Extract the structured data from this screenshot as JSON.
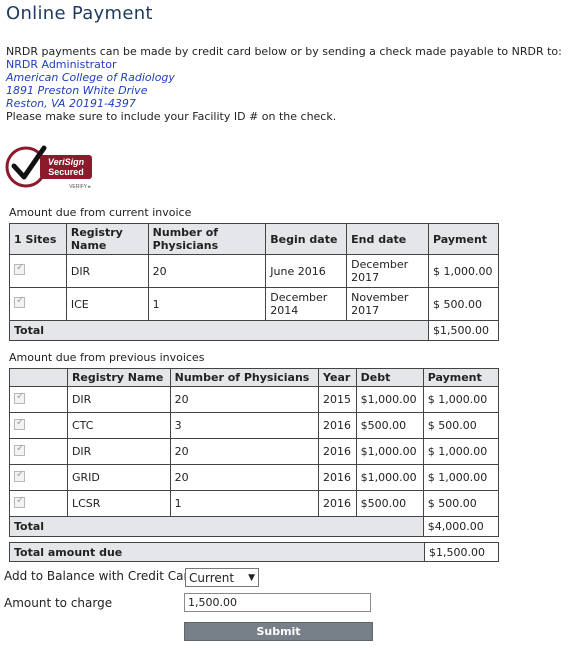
{
  "title": "Online Payment",
  "intro": {
    "line1": "NRDR payments can be made by credit card below or by sending a check made payable to NRDR to:",
    "addr_name": "NRDR Administrator",
    "addr_org": "American College of Radiology",
    "addr_street": "1891 Preston White Drive",
    "addr_city": "Reston, VA 20191-4397",
    "note": "Please make sure to include your Facility ID # on the check."
  },
  "verisign": {
    "line1": "VeriSign",
    "line2": "Secured",
    "line3": "VERIFY ▸"
  },
  "current": {
    "label": "Amount due from current invoice",
    "headers": [
      "1 Sites",
      "Registry Name",
      "Number of Physicians",
      "Begin date",
      "End date",
      "Payment"
    ],
    "rows": [
      {
        "registry": "DIR",
        "physicians": "20",
        "begin": "June 2016",
        "end": "December 2017",
        "payment": "$ 1,000.00"
      },
      {
        "registry": "ICE",
        "physicians": "1",
        "begin": "December 2014",
        "end": "November 2017",
        "payment": "$ 500.00"
      }
    ],
    "total_label": "Total",
    "total": "$1,500.00"
  },
  "previous": {
    "label": "Amount due from previous invoices",
    "headers": [
      "",
      "Registry Name",
      "Number of Physicians",
      "Year",
      "Debt",
      "Payment"
    ],
    "rows": [
      {
        "registry": "DIR",
        "physicians": "20",
        "year": "2015",
        "debt": "$1,000.00",
        "payment": "$ 1,000.00"
      },
      {
        "registry": "CTC",
        "physicians": "3",
        "year": "2016",
        "debt": "$500.00",
        "payment": "$ 500.00"
      },
      {
        "registry": "DIR",
        "physicians": "20",
        "year": "2016",
        "debt": "$1,000.00",
        "payment": "$ 1,000.00"
      },
      {
        "registry": "GRID",
        "physicians": "20",
        "year": "2016",
        "debt": "$1,000.00",
        "payment": "$ 1,000.00"
      },
      {
        "registry": "LCSR",
        "physicians": "1",
        "year": "2016",
        "debt": "$500.00",
        "payment": "$ 500.00"
      }
    ],
    "total_label": "Total",
    "total": "$4,000.00"
  },
  "grand_total": {
    "label": "Total amount due",
    "value": "$1,500.00"
  },
  "form": {
    "balance_label": "Add to Balance with Credit Card",
    "balance_value": "Current",
    "amount_label": "Amount to charge",
    "amount_value": "1,500.00",
    "submit_label": "Submit"
  },
  "colors": {
    "header_bg": "#e4e6ea",
    "link_blue": "#1f3fbf",
    "submit_bg": "#778088",
    "title": "#1f3a5f",
    "verisign_red": "#8b1a2b"
  }
}
